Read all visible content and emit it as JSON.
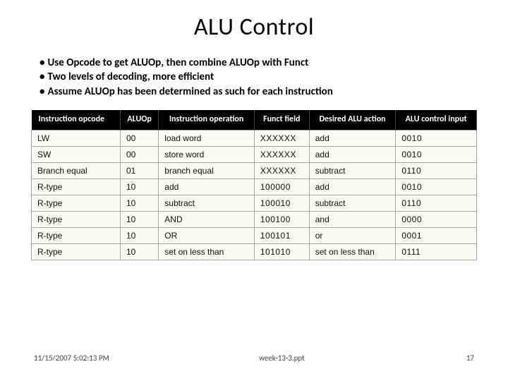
{
  "title": "ALU Control",
  "bullets": [
    "Use Opcode to get ALUOp, then combine ALUOp with Funct",
    "Two levels of decoding, more efficient",
    "Assume ALUOp has been determined as such for each instruction"
  ],
  "headers": [
    "Instruction opcode",
    "ALUOp",
    "Instruction operation",
    "Funct field",
    "Desired ALU action",
    "ALU control input"
  ],
  "chart_data": {
    "type": "table",
    "columns": [
      "Instruction opcode",
      "ALUOp",
      "Instruction operation",
      "Funct field",
      "Desired ALU action",
      "ALU control input"
    ],
    "rows": [
      [
        "LW",
        "00",
        "load word",
        "XXXXXX",
        "add",
        "0010"
      ],
      [
        "SW",
        "00",
        "store word",
        "XXXXXX",
        "add",
        "0010"
      ],
      [
        "Branch equal",
        "01",
        "branch equal",
        "XXXXXX",
        "subtract",
        "0110"
      ],
      [
        "R-type",
        "10",
        "add",
        "100000",
        "add",
        "0010"
      ],
      [
        "R-type",
        "10",
        "subtract",
        "100010",
        "subtract",
        "0110"
      ],
      [
        "R-type",
        "10",
        "AND",
        "100100",
        "and",
        "0000"
      ],
      [
        "R-type",
        "10",
        "OR",
        "100101",
        "or",
        "0001"
      ],
      [
        "R-type",
        "10",
        "set on less than",
        "101010",
        "set on less than",
        "0111"
      ]
    ]
  },
  "footer": {
    "timestamp": "11/15/2007 5:02:13 PM",
    "filename": "week-13-3.ppt",
    "page": "17"
  }
}
